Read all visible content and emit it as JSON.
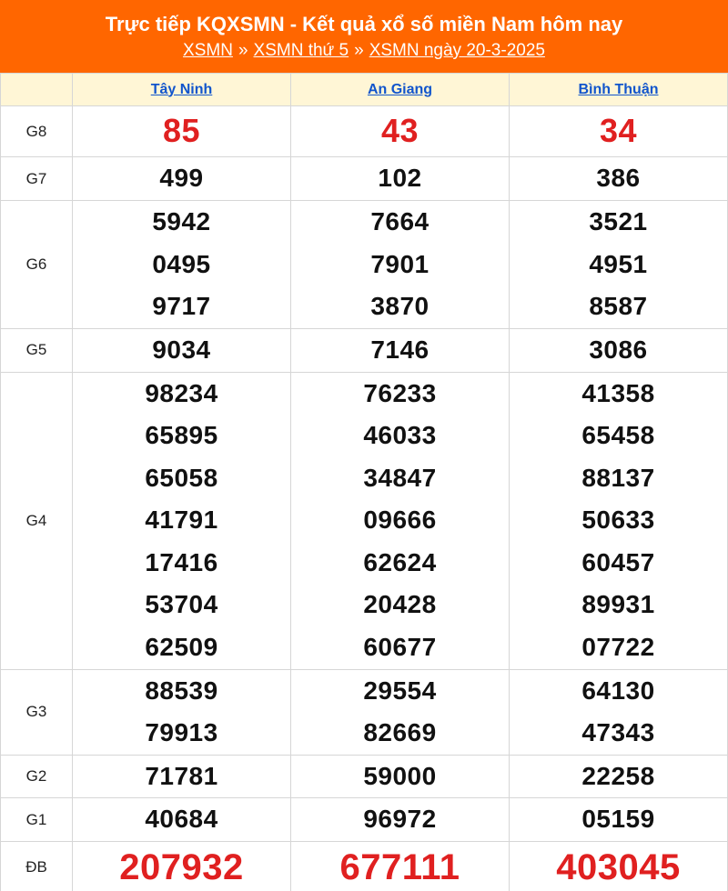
{
  "header": {
    "title": "Trực tiếp KQXSMN - Kết quả xổ số miền Nam hôm nay",
    "crumbs": [
      "XSMN",
      "XSMN thứ 5",
      "XSMN ngày 20-3-2025"
    ],
    "separator": "»"
  },
  "provinces": [
    "Tây Ninh",
    "An Giang",
    "Bình Thuận"
  ],
  "prizes": {
    "g8": {
      "label": "G8",
      "values": [
        [
          "85"
        ],
        [
          "43"
        ],
        [
          "34"
        ]
      ]
    },
    "g7": {
      "label": "G7",
      "values": [
        [
          "499"
        ],
        [
          "102"
        ],
        [
          "386"
        ]
      ]
    },
    "g6": {
      "label": "G6",
      "values": [
        [
          "5942",
          "0495",
          "9717"
        ],
        [
          "7664",
          "7901",
          "3870"
        ],
        [
          "3521",
          "4951",
          "8587"
        ]
      ]
    },
    "g5": {
      "label": "G5",
      "values": [
        [
          "9034"
        ],
        [
          "7146"
        ],
        [
          "3086"
        ]
      ]
    },
    "g4": {
      "label": "G4",
      "values": [
        [
          "98234",
          "65895",
          "65058",
          "41791",
          "17416",
          "53704",
          "62509"
        ],
        [
          "76233",
          "46033",
          "34847",
          "09666",
          "62624",
          "20428",
          "60677"
        ],
        [
          "41358",
          "65458",
          "88137",
          "50633",
          "60457",
          "89931",
          "07722"
        ]
      ]
    },
    "g3": {
      "label": "G3",
      "values": [
        [
          "88539",
          "79913"
        ],
        [
          "29554",
          "82669"
        ],
        [
          "64130",
          "47343"
        ]
      ]
    },
    "g2": {
      "label": "G2",
      "values": [
        [
          "71781"
        ],
        [
          "59000"
        ],
        [
          "22258"
        ]
      ]
    },
    "g1": {
      "label": "G1",
      "values": [
        [
          "40684"
        ],
        [
          "96972"
        ],
        [
          "05159"
        ]
      ]
    },
    "db": {
      "label": "ĐB",
      "values": [
        [
          "207932"
        ],
        [
          "677111"
        ],
        [
          "403045"
        ]
      ]
    }
  },
  "colors": {
    "header_bg": "#ff6600",
    "highlight": "#e02020",
    "link": "#1155cc",
    "head_row_bg": "#fff6d6"
  }
}
